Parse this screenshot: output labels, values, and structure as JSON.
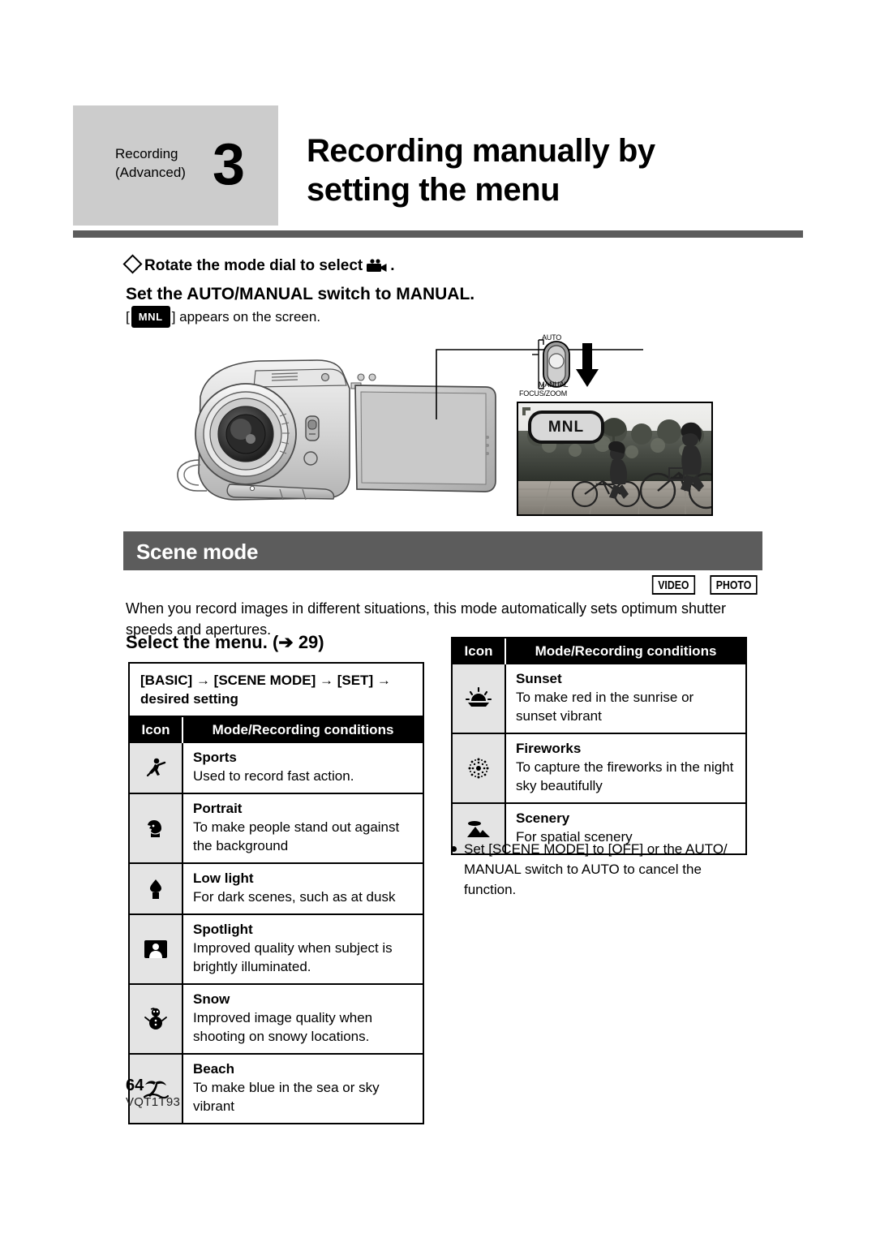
{
  "header": {
    "kicker": "Recording (Advanced)",
    "kicker_line1": "Recording",
    "kicker_line2": "(Advanced)",
    "chapter_number": "3",
    "title_line1": "Recording manually by",
    "title_line2": "setting the menu"
  },
  "steps": {
    "rotate_dial": "Rotate the mode dial to select",
    "rotate_dial_suffix": ".",
    "set_switch": "Set the AUTO/MANUAL switch to MANUAL.",
    "mnl_prefix": "[",
    "mnl_chip": "MNL",
    "mnl_suffix": "] appears on the screen."
  },
  "illustration": {
    "switch_label_auto": "AUTO",
    "switch_label_manual": "MANUAL",
    "switch_label_focus_zoom": "FOCUS/ZOOM",
    "lcd_badge": "MNL"
  },
  "scene_mode": {
    "section_title": "Scene mode",
    "media_badges": [
      "VIDEO",
      "PHOTO"
    ],
    "intro": "When you record images in different situations, this mode automatically sets optimum shutter speeds and apertures.",
    "select_menu_heading": "Select the menu. (➔ 29)",
    "menu_path": "[BASIC] → [SCENE MODE] → [SET] → desired setting",
    "table_headers": {
      "icon": "Icon",
      "conditions": "Mode/Recording conditions"
    },
    "left_rows": [
      {
        "icon": "sports-icon",
        "name": "Sports",
        "desc": "Used to record fast action."
      },
      {
        "icon": "portrait-icon",
        "name": "Portrait",
        "desc": "To make people stand out against the background"
      },
      {
        "icon": "lowlight-icon",
        "name": "Low light",
        "desc": "For dark scenes, such as at dusk"
      },
      {
        "icon": "spotlight-icon",
        "name": "Spotlight",
        "desc": "Improved quality when subject is brightly illuminated."
      },
      {
        "icon": "snow-icon",
        "name": "Snow",
        "desc": "Improved image quality when shooting on snowy locations."
      },
      {
        "icon": "beach-icon",
        "name": "Beach",
        "desc": "To make blue in the sea or sky vibrant"
      }
    ],
    "right_rows": [
      {
        "icon": "sunset-icon",
        "name": "Sunset",
        "desc": "To make red in the sunrise or sunset vibrant"
      },
      {
        "icon": "fireworks-icon",
        "name": "Fireworks",
        "desc": "To capture the fireworks in the night sky beautifully"
      },
      {
        "icon": "scenery-icon",
        "name": "Scenery",
        "desc": "For spatial scenery"
      }
    ],
    "note": "Set [SCENE MODE] to [OFF] or the AUTO/ MANUAL switch to AUTO to cancel the function."
  },
  "footer": {
    "page_number": "64",
    "document_code": "VQT1T93"
  },
  "colors": {
    "chapter_tab_gray": "#cccccc",
    "rule_gray": "#5c5c5c",
    "section_bar_gray": "#5c5c5c",
    "table_header_black": "#000000",
    "icon_cell_gray": "#e4e4e4"
  }
}
